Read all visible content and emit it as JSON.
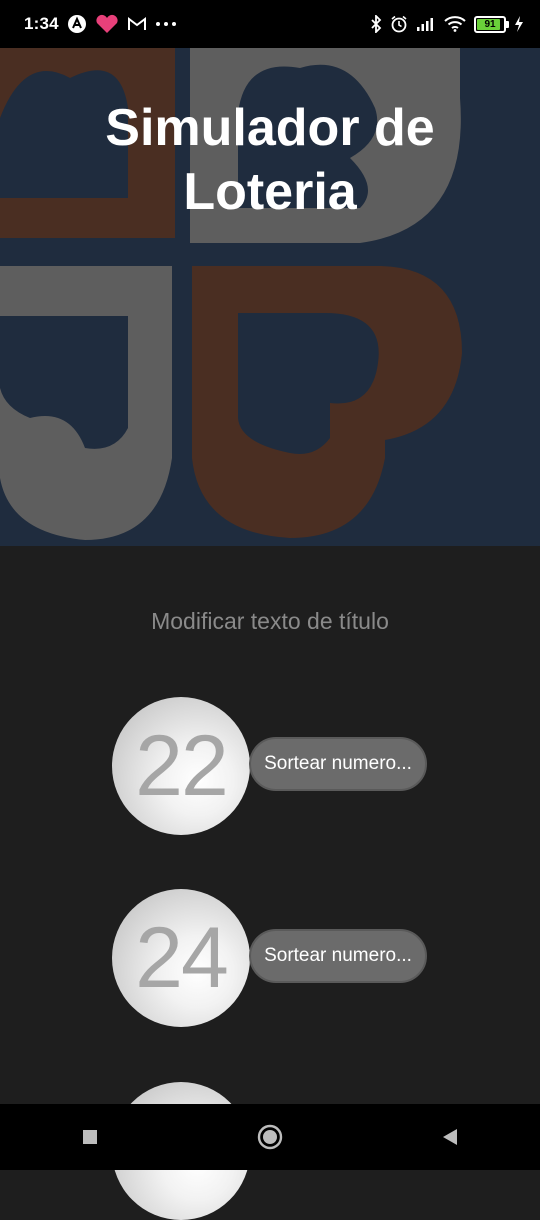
{
  "status_bar": {
    "time": "1:34",
    "battery": "91",
    "icons": [
      "app-a-icon",
      "heart-app-icon",
      "gmail-icon",
      "more-dots-icon",
      "bluetooth-icon",
      "alarm-icon",
      "signal-icon",
      "wifi-icon",
      "battery-icon",
      "charging-icon"
    ]
  },
  "header": {
    "title_line1": "Simulador de",
    "title_line2": "Loteria"
  },
  "subtitle": "Modificar texto de título",
  "rows": [
    {
      "number": "22",
      "button_label": "Sortear numero..."
    },
    {
      "number": "24",
      "button_label": "Sortear numero..."
    }
  ],
  "colors": {
    "header_bg": "#1f2c3e",
    "tile_orange": "#4a2e22",
    "tile_gray": "#5e5e5e",
    "background": "#1e1e1e",
    "button_bg": "#6b6b6b"
  },
  "nav_bar": {
    "icons": [
      "recent-apps-icon",
      "home-icon",
      "back-icon"
    ]
  }
}
